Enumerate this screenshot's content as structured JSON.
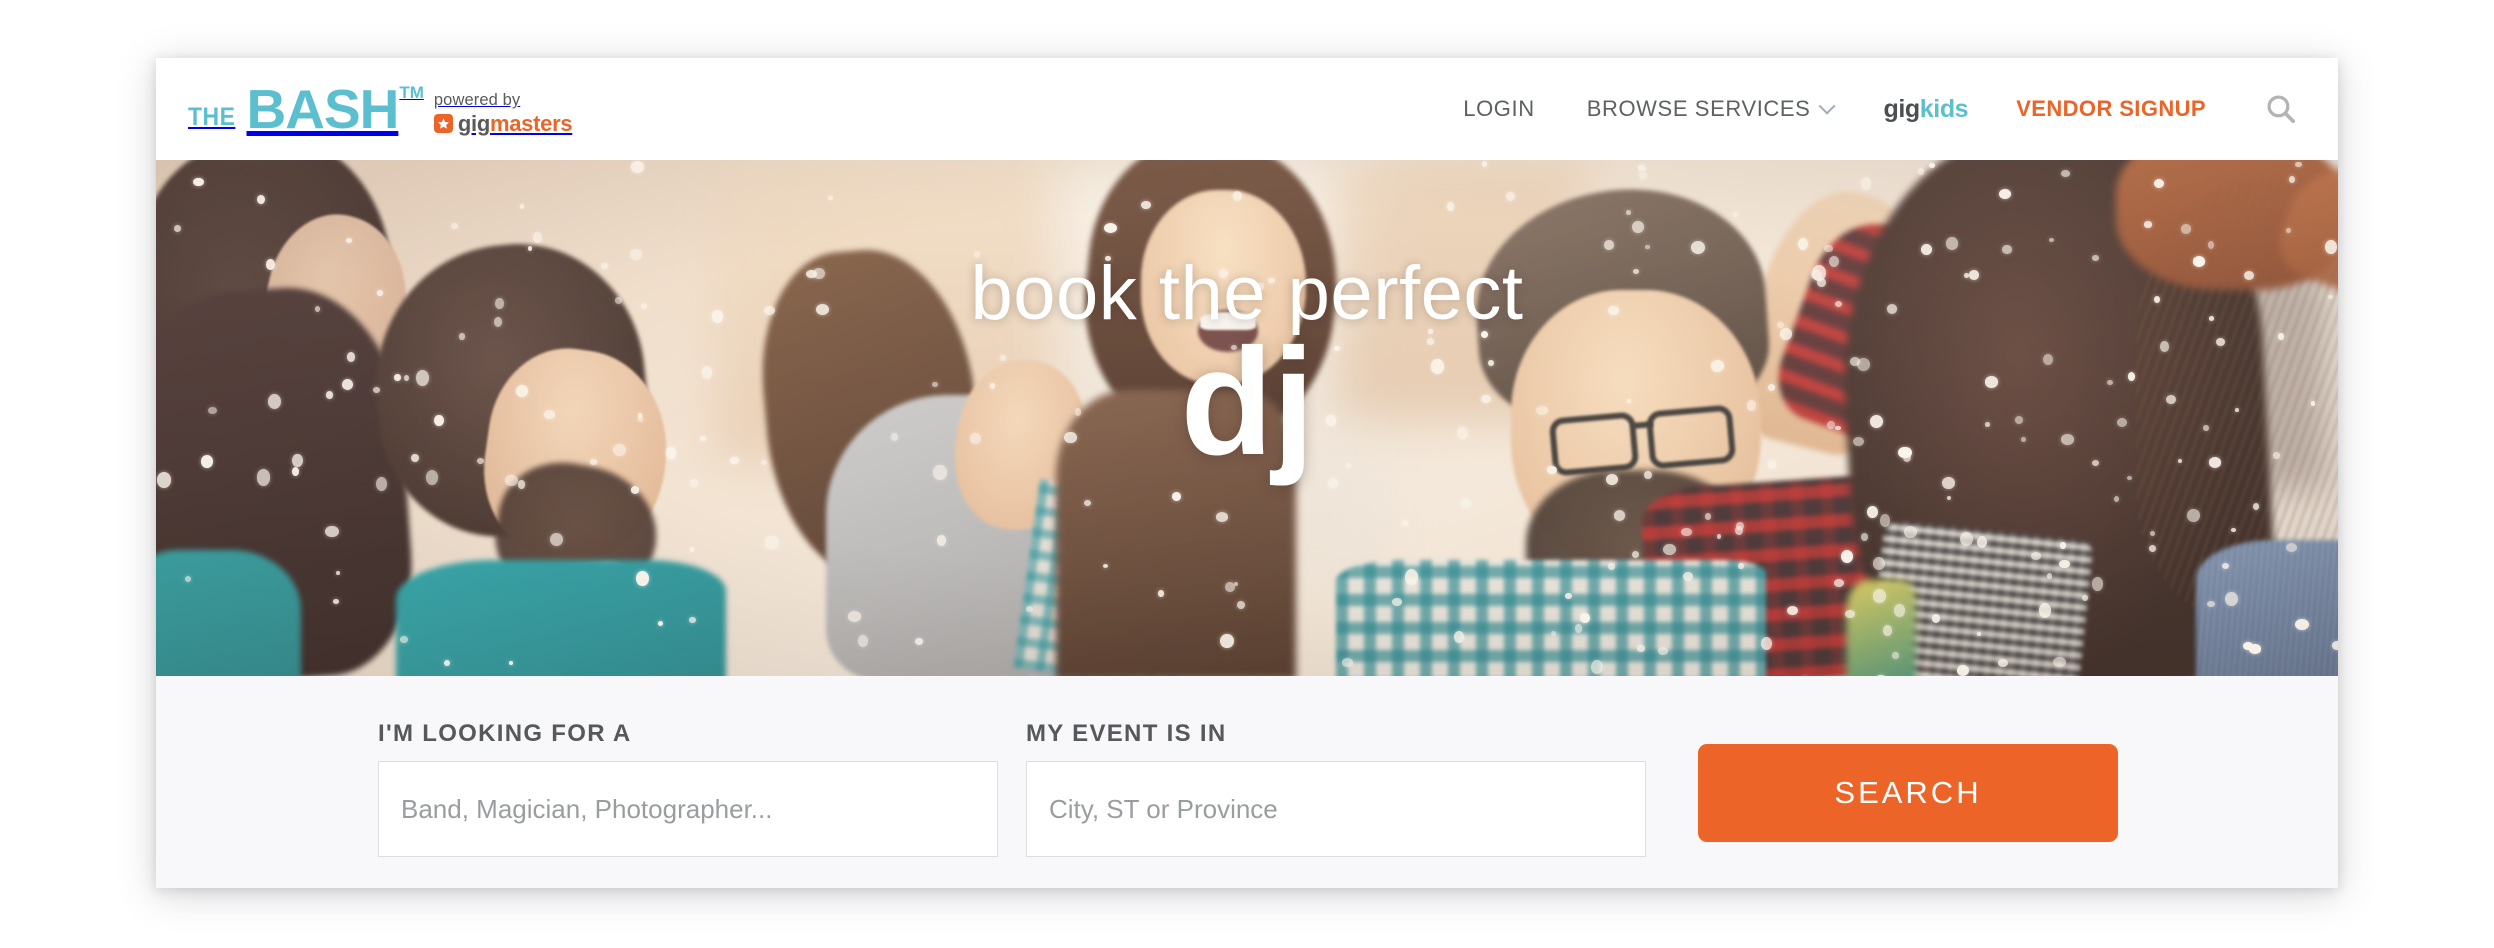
{
  "brand": {
    "logo_the": "THE",
    "logo_bash": "BASH",
    "logo_tm": "TM",
    "powered_by": "powered by",
    "gigmasters_gig": "gig",
    "gigmasters_masters": "masters",
    "teal": "#5BBFD0",
    "orange": "#EC6428",
    "gray": "#5A5A5A"
  },
  "nav": {
    "login": "LOGIN",
    "browse_services": "BROWSE SERVICES",
    "gigkids_gig": "gig",
    "gigkids_kids": "kids",
    "vendor_signup": "VENDOR SIGNUP",
    "search_icon": "search-icon",
    "chevron_icon": "chevron-down-icon"
  },
  "hero": {
    "line1": "book the perfect",
    "line2": "dj"
  },
  "search": {
    "what_label": "I'M LOOKING FOR A",
    "what_placeholder": "Band, Magician, Photographer...",
    "what_value": "",
    "where_label": "MY EVENT IS IN",
    "where_placeholder": "City, ST or Province",
    "where_value": "",
    "button_label": "SEARCH",
    "button_color": "#EC6428"
  }
}
